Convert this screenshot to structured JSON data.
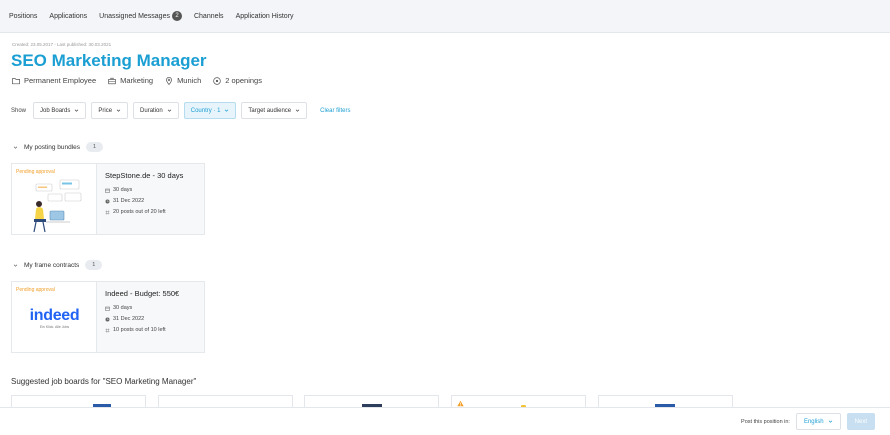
{
  "nav": {
    "items": [
      {
        "label": "Positions"
      },
      {
        "label": "Applications"
      },
      {
        "label": "Unassigned Messages",
        "badge": "2"
      },
      {
        "label": "Channels"
      },
      {
        "label": "Application History"
      }
    ]
  },
  "position": {
    "meta": "Created: 23.05.2017 - Last published: 30.03.2021",
    "title": "SEO Marketing Manager",
    "employment": "Permanent Employee",
    "department": "Marketing",
    "location": "Munich",
    "openings": "2 openings"
  },
  "filters": {
    "show_label": "Show",
    "items": [
      {
        "label": "Job Boards",
        "active": false
      },
      {
        "label": "Price",
        "active": false
      },
      {
        "label": "Duration",
        "active": false
      },
      {
        "label": "Country · 1",
        "active": true
      },
      {
        "label": "Target audience",
        "active": false
      }
    ],
    "clear_label": "Clear filters"
  },
  "bundles": {
    "title": "My posting bundles",
    "count": "1",
    "card": {
      "status": "Pending approval",
      "title": "StepStone.de - 30 days",
      "duration": "30 days",
      "date": "31 Dec 2022",
      "posts": "20 posts out of 20 left"
    }
  },
  "contracts": {
    "title": "My frame contracts",
    "count": "1",
    "card": {
      "status": "Pending approval",
      "logo_text": "indeed",
      "logo_tagline": "Ein Klick. Alle Jobs",
      "title": "Indeed - Budget: 550€",
      "duration": "30 days",
      "date": "31 Dec 2022",
      "posts": "10 posts out of 10 left"
    }
  },
  "suggested": {
    "title": "Suggested job boards for \"SEO Marketing Manager\""
  },
  "footer": {
    "post_text": "Post this position in:",
    "language": "English",
    "next_label": "Next"
  },
  "colors": {
    "accent": "#1b9fd3",
    "pending": "#f29f2a",
    "indeed": "#2164f3"
  }
}
